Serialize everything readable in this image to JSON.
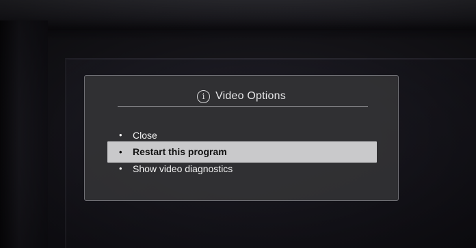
{
  "dialog": {
    "icon": "info-icon",
    "title": "Video Options",
    "items": [
      {
        "label": "Close",
        "selected": false
      },
      {
        "label": "Restart this program",
        "selected": true
      },
      {
        "label": "Show video diagnostics",
        "selected": false
      }
    ]
  },
  "colors": {
    "dialog_bg": "#343437",
    "highlight": "#c9c9cb",
    "text": "#f2f2f2"
  }
}
